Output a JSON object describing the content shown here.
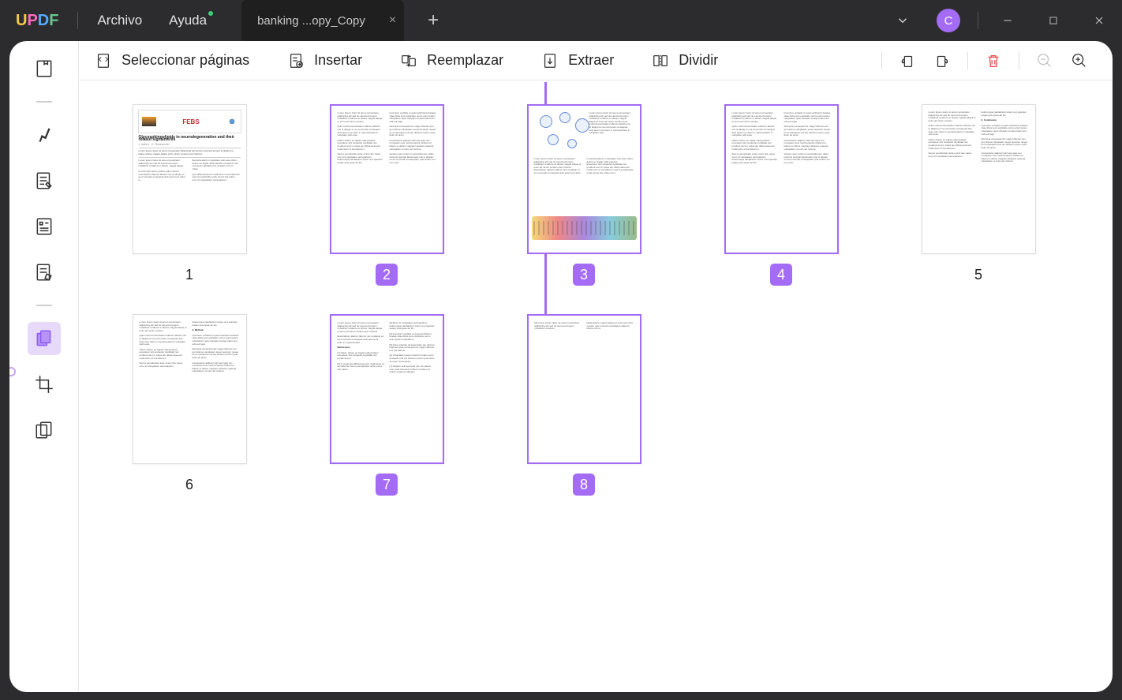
{
  "logo": {
    "l1": "U",
    "l2": "P",
    "l3": "D",
    "l4": "F"
  },
  "menu": {
    "archivo": "Archivo",
    "ayuda": "Ayuda"
  },
  "tab": {
    "title": "banking ...opy_Copy"
  },
  "avatar_letter": "C",
  "toolbar": {
    "select": "Seleccionar páginas",
    "insert": "Insertar",
    "replace": "Reemplazar",
    "extract": "Extraer",
    "split": "Dividir"
  },
  "page_numbers": [
    "1",
    "2",
    "3",
    "4",
    "5",
    "6",
    "7",
    "8"
  ],
  "selected_pages": [
    2,
    3,
    4,
    7,
    8
  ],
  "insert_after_page": 2
}
